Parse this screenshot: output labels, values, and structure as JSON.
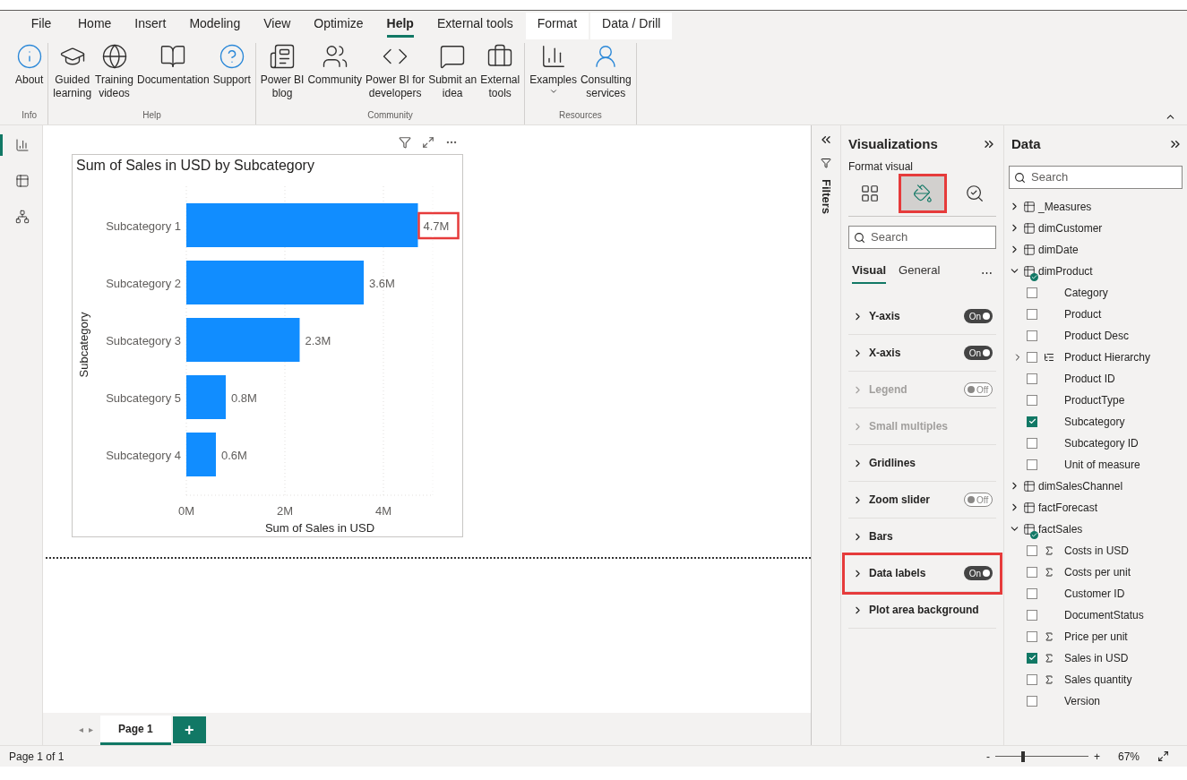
{
  "menu_tabs": [
    {
      "label": "File",
      "selected": false,
      "kind": "normal"
    },
    {
      "label": "Home",
      "selected": false,
      "kind": "normal"
    },
    {
      "label": "Insert",
      "selected": false,
      "kind": "normal"
    },
    {
      "label": "Modeling",
      "selected": false,
      "kind": "normal"
    },
    {
      "label": "View",
      "selected": false,
      "kind": "normal"
    },
    {
      "label": "Optimize",
      "selected": false,
      "kind": "normal"
    },
    {
      "label": "Help",
      "selected": true,
      "kind": "normal"
    },
    {
      "label": "External tools",
      "selected": false,
      "kind": "normal"
    },
    {
      "label": "Format",
      "selected": false,
      "kind": "contextual"
    },
    {
      "label": "Data / Drill",
      "selected": false,
      "kind": "contextual"
    }
  ],
  "ribbon_groups": [
    {
      "name": "Info",
      "buttons": [
        {
          "label": "About",
          "kind": "info",
          "dropdown": false
        }
      ]
    },
    {
      "name": "Help",
      "buttons": [
        {
          "label": "Guided\nlearning",
          "kind": "learning",
          "dropdown": false
        },
        {
          "label": "Training\nvideos",
          "kind": "videos",
          "dropdown": false
        },
        {
          "label": "Documentation",
          "kind": "docs",
          "dropdown": false
        },
        {
          "label": "Support",
          "kind": "support",
          "dropdown": false
        }
      ]
    },
    {
      "name": "Community",
      "buttons": [
        {
          "label": "Power BI\nblog",
          "kind": "blog",
          "dropdown": false
        },
        {
          "label": "Community",
          "kind": "community",
          "dropdown": false
        },
        {
          "label": "Power BI for\ndevelopers",
          "kind": "code",
          "dropdown": false
        },
        {
          "label": "Submit an\nidea",
          "kind": "idea",
          "dropdown": false
        },
        {
          "label": "External\ntools",
          "kind": "tools",
          "dropdown": false
        }
      ]
    },
    {
      "name": "Resources",
      "buttons": [
        {
          "label": "Examples",
          "kind": "examples",
          "dropdown": true
        },
        {
          "label": "Consulting\nservices",
          "kind": "consulting",
          "dropdown": false
        }
      ]
    }
  ],
  "left_nav": [
    {
      "kind": "report",
      "selected": true
    },
    {
      "kind": "table",
      "selected": false
    },
    {
      "kind": "model",
      "selected": false
    }
  ],
  "visual": {
    "chart_data": {
      "type": "bar",
      "orientation": "horizontal",
      "title": "Sum of Sales in USD by Subcategory",
      "xlabel": "Sum of Sales in USD",
      "ylabel": "Subcategory",
      "categories": [
        "Subcategory 1",
        "Subcategory 2",
        "Subcategory 3",
        "Subcategory 5",
        "Subcategory 4"
      ],
      "values": [
        4.7,
        3.6,
        2.3,
        0.8,
        0.6
      ],
      "xlim": [
        0,
        5
      ],
      "xticks": [
        {
          "value": 0,
          "label": "0M"
        },
        {
          "value": 2,
          "label": "2M"
        },
        {
          "value": 4,
          "label": "4M"
        }
      ],
      "value_labels": [
        "4.7M",
        "3.6M",
        "2.3M",
        "0.8M",
        "0.6M"
      ]
    },
    "label_highlights": [
      true,
      false,
      false,
      false,
      false
    ]
  },
  "filters": {
    "title": "Filters"
  },
  "visualizations": {
    "title": "Visualizations",
    "subtitle": "Format visual",
    "mode_tabs": [
      {
        "kind": "build",
        "selected": false,
        "highlighted": false
      },
      {
        "kind": "format",
        "selected": true,
        "highlighted": true
      },
      {
        "kind": "analytics",
        "selected": false,
        "highlighted": false
      }
    ],
    "search": {
      "placeholder": "Search"
    },
    "sub_tabs": [
      {
        "label": "Visual",
        "selected": true
      },
      {
        "label": "General",
        "selected": false
      }
    ],
    "more": "⋯",
    "sections": [
      {
        "label": "Y-axis",
        "disabled": false,
        "highlighted": false,
        "toggle": {
          "on": true,
          "label": "On"
        }
      },
      {
        "label": "X-axis",
        "disabled": false,
        "highlighted": false,
        "toggle": {
          "on": true,
          "label": "On"
        }
      },
      {
        "label": "Legend",
        "disabled": true,
        "highlighted": false,
        "toggle": {
          "on": false,
          "label": "Off"
        }
      },
      {
        "label": "Small multiples",
        "disabled": true,
        "highlighted": false
      },
      {
        "label": "Gridlines",
        "disabled": false,
        "highlighted": false
      },
      {
        "label": "Zoom slider",
        "disabled": false,
        "highlighted": false,
        "toggle": {
          "on": false,
          "label": "Off"
        }
      },
      {
        "label": "Bars",
        "disabled": false,
        "highlighted": false
      },
      {
        "label": "Data labels",
        "disabled": false,
        "highlighted": true,
        "toggle": {
          "on": true,
          "label": "On"
        }
      },
      {
        "label": "Plot area background",
        "disabled": false,
        "highlighted": false
      }
    ]
  },
  "data": {
    "title": "Data",
    "search": {
      "placeholder": "Search"
    },
    "tables": [
      {
        "name": "_Measures",
        "expanded": false,
        "in_use": false
      },
      {
        "name": "dimCustomer",
        "expanded": false,
        "in_use": false
      },
      {
        "name": "dimDate",
        "expanded": false,
        "in_use": false
      },
      {
        "name": "dimProduct",
        "expanded": true,
        "in_use": true,
        "children": [
          {
            "name": "Category",
            "kind": "column",
            "checked": false
          },
          {
            "name": "Product",
            "kind": "column",
            "checked": false
          },
          {
            "name": "Product Desc",
            "kind": "column",
            "checked": false
          },
          {
            "name": "Product Hierarchy",
            "kind": "hierarchy",
            "checked": false
          },
          {
            "name": "Product ID",
            "kind": "column",
            "checked": false
          },
          {
            "name": "ProductType",
            "kind": "column",
            "checked": false
          },
          {
            "name": "Subcategory",
            "kind": "column",
            "checked": true
          },
          {
            "name": "Subcategory ID",
            "kind": "column",
            "checked": false
          },
          {
            "name": "Unit of measure",
            "kind": "column",
            "checked": false
          }
        ]
      },
      {
        "name": "dimSalesChannel",
        "expanded": false,
        "in_use": false
      },
      {
        "name": "factForecast",
        "expanded": false,
        "in_use": false
      },
      {
        "name": "factSales",
        "expanded": true,
        "in_use": true,
        "children": [
          {
            "name": "Costs in USD",
            "kind": "measure",
            "checked": false
          },
          {
            "name": "Costs per unit",
            "kind": "measure",
            "checked": false
          },
          {
            "name": "Customer ID",
            "kind": "column",
            "checked": false
          },
          {
            "name": "DocumentStatus",
            "kind": "column",
            "checked": false
          },
          {
            "name": "Price per unit",
            "kind": "measure",
            "checked": false
          },
          {
            "name": "Sales in USD",
            "kind": "measure",
            "checked": true
          },
          {
            "name": "Sales quantity",
            "kind": "measure",
            "checked": false
          },
          {
            "name": "Version",
            "kind": "column",
            "checked": false
          }
        ]
      }
    ]
  },
  "page_tabs": [
    {
      "label": "Page 1",
      "selected": true
    }
  ],
  "page_nav": {
    "prev": "◂",
    "next": "▸"
  },
  "add_page": "+",
  "status_bar": {
    "page": "Page 1 of 1",
    "zoom_out": "-",
    "zoom_in": "+",
    "zoom": {
      "level": 0.3
    },
    "zoom_reading": "67%"
  }
}
